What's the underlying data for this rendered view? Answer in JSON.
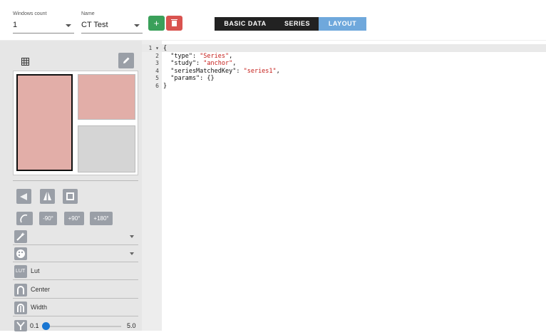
{
  "header": {
    "windows_count": {
      "label": "Windows count",
      "value": "1"
    },
    "name": {
      "label": "Name",
      "value": "CT Test"
    },
    "add_label": "+",
    "tabs": [
      {
        "label": "BASIC DATA",
        "active": false
      },
      {
        "label": "SERIES",
        "active": false
      },
      {
        "label": "LAYOUT",
        "active": true
      }
    ]
  },
  "sidebar": {
    "rotation_buttons": [
      "-90°",
      "+90°",
      "+180°"
    ],
    "rows": [
      {
        "icon": "wand-icon",
        "text": ""
      },
      {
        "icon": "palette-icon",
        "text": ""
      },
      {
        "icon": "lut-icon",
        "text": "Lut",
        "icon_text": "LUT"
      },
      {
        "icon": "center-icon",
        "text": "Center"
      },
      {
        "icon": "width-icon",
        "text": "Width"
      }
    ],
    "slider": {
      "min": "0.1",
      "max": "5.0",
      "value": 0.1
    }
  },
  "editor": {
    "lines": [
      {
        "num": "1",
        "parts": [
          [
            "p",
            "{"
          ]
        ]
      },
      {
        "num": "2",
        "parts": [
          [
            "p",
            "  \"type\": "
          ],
          [
            "s",
            "\"Series\""
          ],
          [
            "p",
            ","
          ]
        ]
      },
      {
        "num": "3",
        "parts": [
          [
            "p",
            "  \"study\": "
          ],
          [
            "s",
            "\"anchor\""
          ],
          [
            "p",
            ","
          ]
        ]
      },
      {
        "num": "4",
        "parts": [
          [
            "p",
            "  \"seriesMatchedKey\": "
          ],
          [
            "s",
            "\"series1\""
          ],
          [
            "p",
            ","
          ]
        ]
      },
      {
        "num": "5",
        "parts": [
          [
            "p",
            "  \"params\": {}"
          ]
        ]
      },
      {
        "num": "6",
        "parts": [
          [
            "p",
            "}"
          ]
        ]
      }
    ]
  },
  "colors": {
    "add": "#3aa05a",
    "delete": "#d9534f",
    "active_tab": "#6fa8dc",
    "window_pink": "#e2aea8"
  }
}
